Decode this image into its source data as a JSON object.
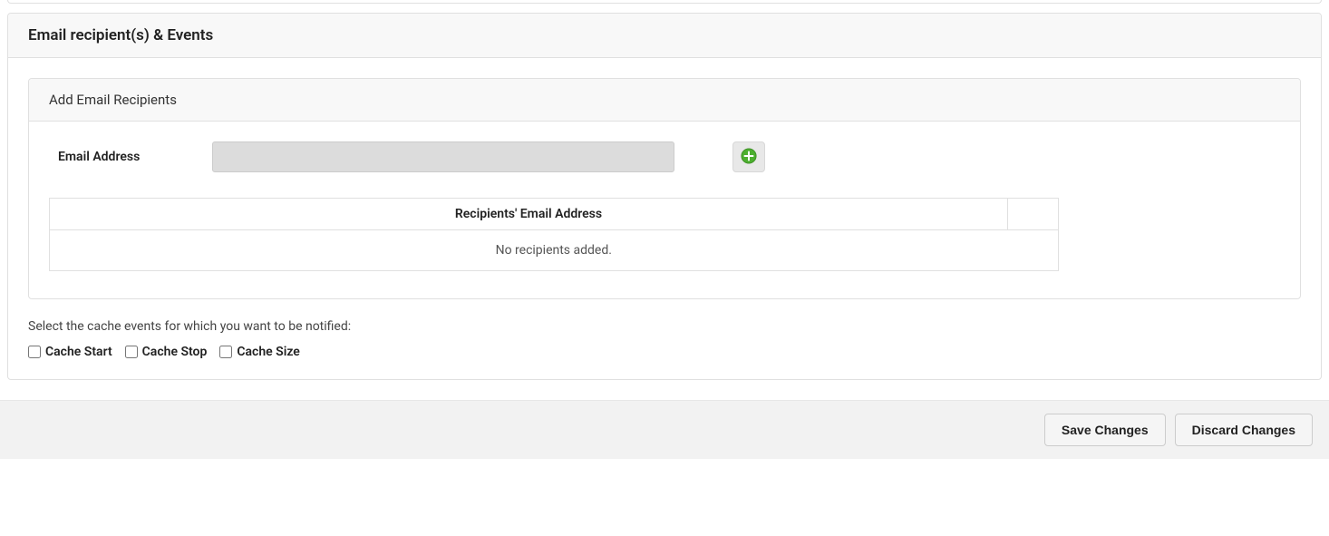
{
  "panel": {
    "title": "Email recipient(s) & Events",
    "addSection": {
      "title": "Add Email Recipients",
      "emailLabel": "Email Address",
      "emailValue": "",
      "table": {
        "headerMain": "Recipients' Email Address",
        "emptyMessage": "No recipients added."
      }
    },
    "events": {
      "instruction": "Select the cache events for which you want to be notified:",
      "options": {
        "cacheStart": "Cache Start",
        "cacheStop": "Cache Stop",
        "cacheSize": "Cache Size"
      }
    }
  },
  "footer": {
    "save": "Save Changes",
    "discard": "Discard Changes"
  }
}
